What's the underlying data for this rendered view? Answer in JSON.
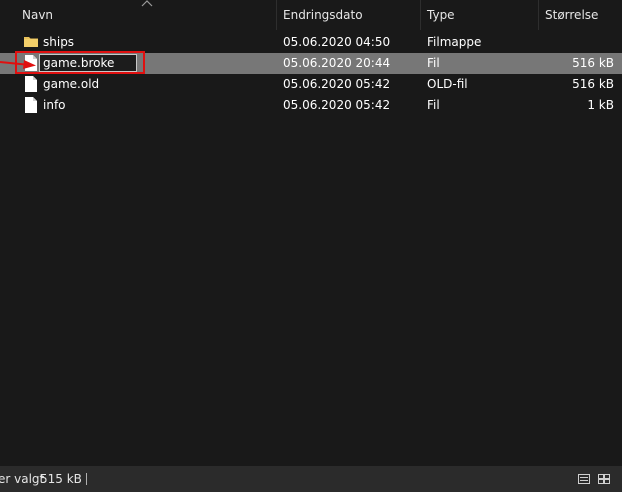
{
  "columns": {
    "name": "Navn",
    "date": "Endringsdato",
    "type": "Type",
    "size": "Størrelse"
  },
  "files": [
    {
      "name": "ships",
      "date": "05.06.2020 04:50",
      "type": "Filmappe",
      "size": "",
      "icon": "folder-icon"
    },
    {
      "name": "game.broke",
      "date": "05.06.2020 20:44",
      "type": "Fil",
      "size": "516 kB",
      "icon": "file-icon",
      "selected": true,
      "renaming": true
    },
    {
      "name": "game.old",
      "date": "05.06.2020 05:42",
      "type": "OLD-fil",
      "size": "516 kB",
      "icon": "file-icon"
    },
    {
      "name": "info",
      "date": "05.06.2020 05:42",
      "type": "Fil",
      "size": "1 kB",
      "icon": "file-icon"
    }
  ],
  "status": {
    "selection": "er valgt",
    "size": "515 kB"
  },
  "colors": {
    "background": "#191919",
    "selected_row": "#777777",
    "highlight": "#e01010",
    "folder": "#e8c15a"
  }
}
